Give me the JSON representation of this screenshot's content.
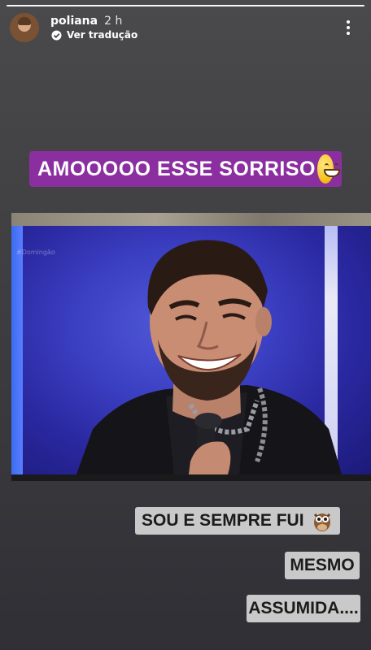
{
  "story": {
    "username": "poliana",
    "time_ago": "2 h",
    "translate_label": "Ver tradução",
    "more_icon": "more-vertical-icon",
    "avatar_icon": "user-avatar"
  },
  "stickers": {
    "title": "AMOOOOO ESSE SORRISO",
    "title_emoji": "grinning-face-emoji",
    "title_bg": "#8b2fa0",
    "line1": "SOU E SEMPRE FUI",
    "line1_emoji": "owl-emoji",
    "line2": "MESMO",
    "line3": "ASSUMIDA....",
    "tag_bg": "#c9c9c9"
  },
  "photo": {
    "subject": "tv-screen-photo",
    "watermark": "#Domingão"
  }
}
